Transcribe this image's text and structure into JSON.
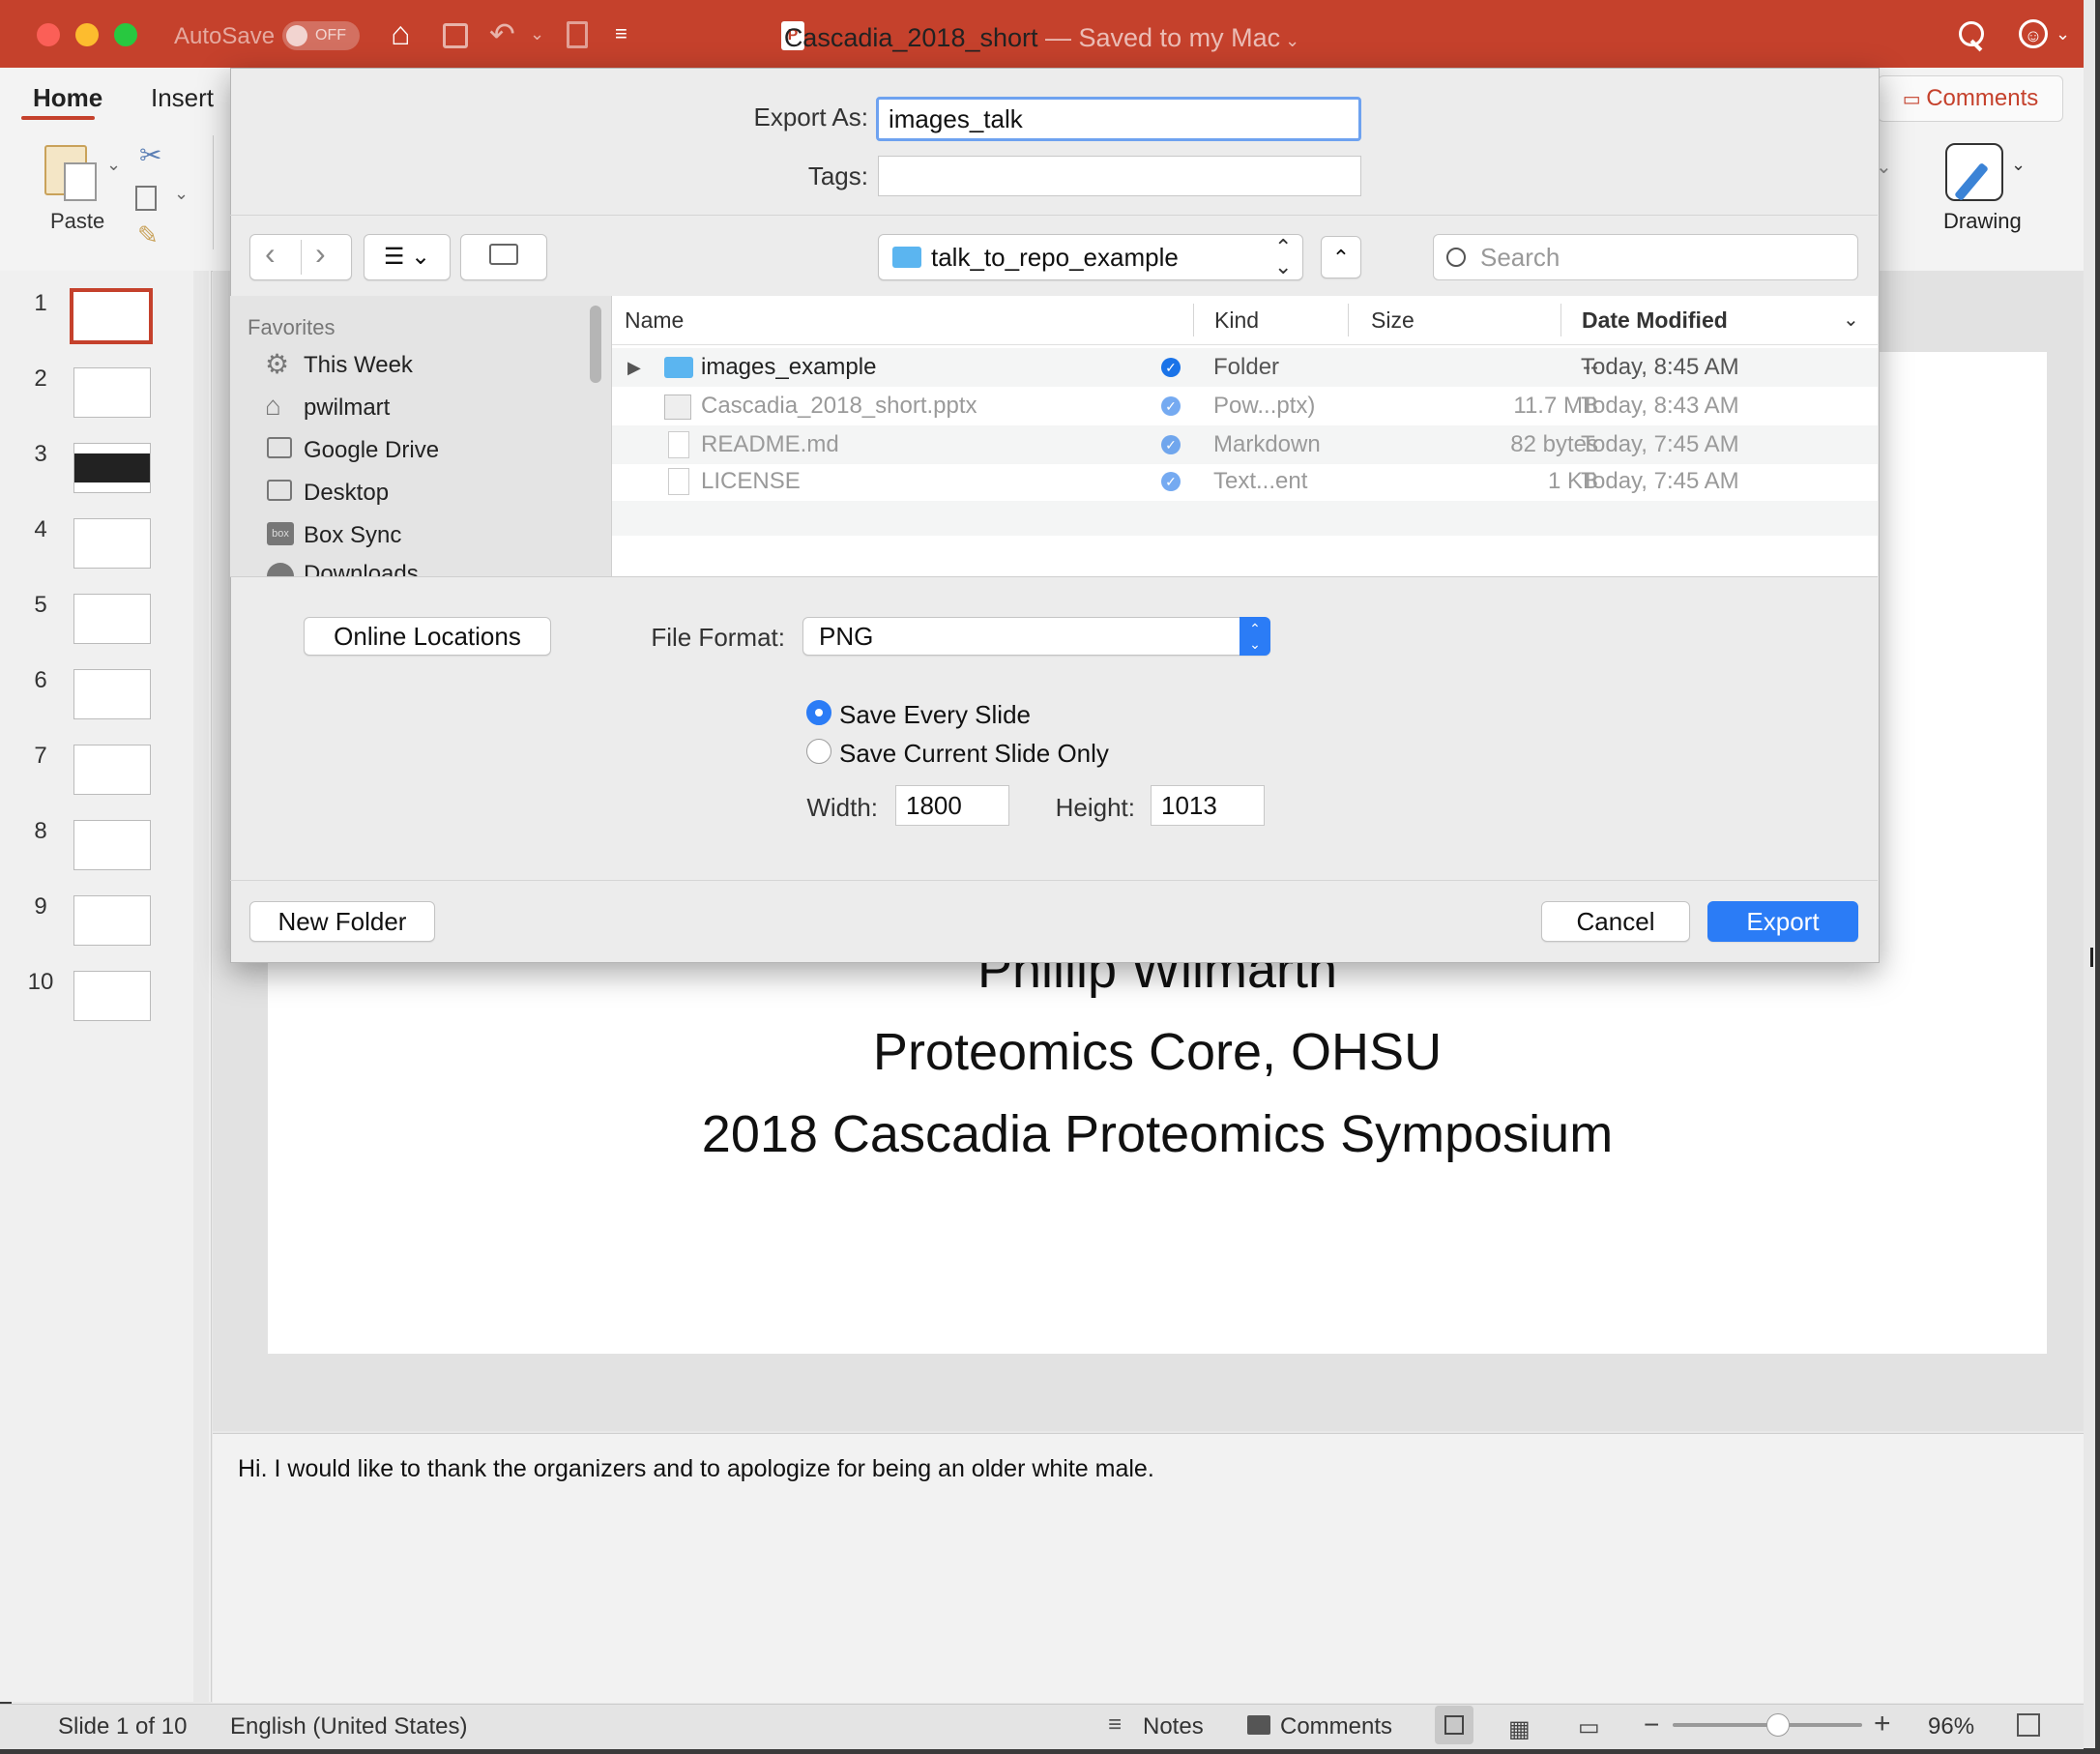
{
  "titlebar": {
    "autosave_label": "AutoSave",
    "autosave_state": "OFF",
    "doc_name": "Cascadia_2018_short",
    "doc_status": " — Saved to my Mac"
  },
  "ribbon": {
    "tabs": [
      "Home",
      "Insert"
    ],
    "paste_label": "Paste",
    "drawing_label": "Drawing",
    "comments_label": "Comments"
  },
  "slides": {
    "numbers": [
      "1",
      "2",
      "3",
      "4",
      "5",
      "6",
      "7",
      "8",
      "9",
      "10"
    ],
    "current": 1
  },
  "slide_content": {
    "line1": "Phillip Wilmarth",
    "line2": "Proteomics Core, OHSU",
    "line3": "2018 Cascadia Proteomics Symposium"
  },
  "notes": {
    "text": "Hi. I would like to thank the organizers and to apologize for being an older white male."
  },
  "statusbar": {
    "slide_info": "Slide 1 of 10",
    "language": "English (United States)",
    "notes_label": "Notes",
    "comments_label": "Comments",
    "zoom": "96%",
    "zoom_level": 0.55
  },
  "dialog": {
    "export_as_label": "Export As:",
    "export_as_value": "images_talk",
    "tags_label": "Tags:",
    "tags_value": "",
    "location": "talk_to_repo_example",
    "search_placeholder": "Search",
    "favorites_heading": "Favorites",
    "favorites": [
      "This Week",
      "pwilmart",
      "Google Drive",
      "Desktop",
      "Box Sync",
      "Downloads"
    ],
    "columns": {
      "name": "Name",
      "kind": "Kind",
      "size": "Size",
      "date": "Date Modified"
    },
    "files": [
      {
        "name": "images_example",
        "kind": "Folder",
        "size": "--",
        "date": "Today, 8:45 AM",
        "icon": "folder-icon",
        "enabled": true
      },
      {
        "name": "Cascadia_2018_short.pptx",
        "kind": "Pow...ptx)",
        "size": "11.7 MB",
        "date": "Today, 8:43 AM",
        "icon": "pptx-file-icon",
        "enabled": false
      },
      {
        "name": "README.md",
        "kind": "Markdown",
        "size": "82 bytes",
        "date": "Today, 7:45 AM",
        "icon": "document-icon",
        "enabled": false
      },
      {
        "name": "LICENSE",
        "kind": "Text...ent",
        "size": "1 KB",
        "date": "Today, 7:45 AM",
        "icon": "document-icon",
        "enabled": false
      }
    ],
    "online_locations_label": "Online Locations",
    "file_format_label": "File Format:",
    "file_format_value": "PNG",
    "save_every_slide_label": "Save Every Slide",
    "save_current_slide_label": "Save Current Slide Only",
    "save_every_slide_selected": true,
    "width_label": "Width:",
    "width_value": "1800",
    "height_label": "Height:",
    "height_value": "1013",
    "new_folder_label": "New Folder",
    "cancel_label": "Cancel",
    "export_label": "Export"
  },
  "colors": {
    "titlebar": "#c5412c",
    "accent_blue": "#1a73e8",
    "folder_blue": "#5bb5f0"
  }
}
